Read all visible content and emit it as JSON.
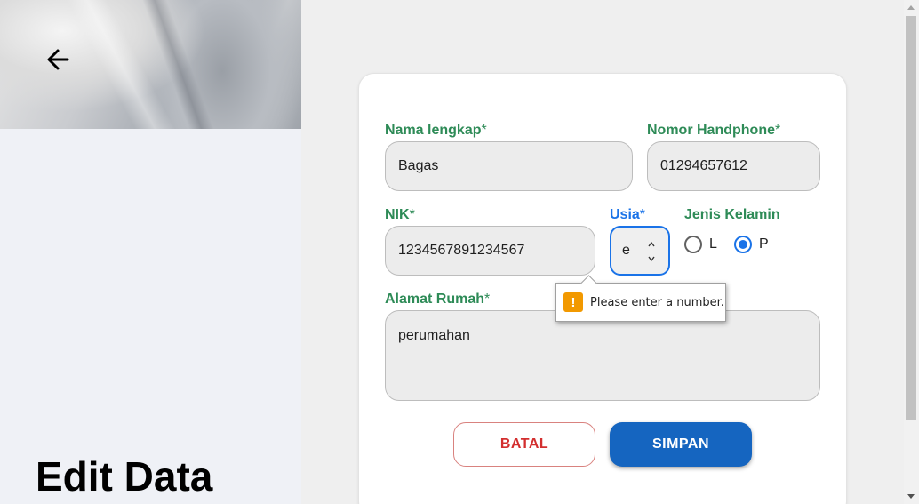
{
  "page": {
    "title": "Edit Data"
  },
  "icons": {
    "back": "arrow-left-icon",
    "warning": "exclamation-icon"
  },
  "form": {
    "required_mark": "*",
    "nama": {
      "label": "Nama lengkap",
      "value": "Bagas"
    },
    "phone": {
      "label": "Nomor Handphone",
      "value": "01294657612"
    },
    "nik": {
      "label": "NIK",
      "value": "1234567891234567"
    },
    "usia": {
      "label": "Usia",
      "value": "e"
    },
    "jenis_kelamin": {
      "label": "Jenis Kelamin",
      "options": [
        {
          "label": "L",
          "checked": false
        },
        {
          "label": "P",
          "checked": true
        }
      ]
    },
    "alamat": {
      "label": "Alamat Rumah",
      "value": "perumahan"
    }
  },
  "validation": {
    "message": "Please enter a number."
  },
  "actions": {
    "cancel_label": "BATAL",
    "save_label": "SIMPAN"
  },
  "colors": {
    "label_green": "#2e8b57",
    "focus_blue": "#1a73e8",
    "primary": "#1565c0",
    "danger": "#d32f2f",
    "warning": "#f29900"
  }
}
